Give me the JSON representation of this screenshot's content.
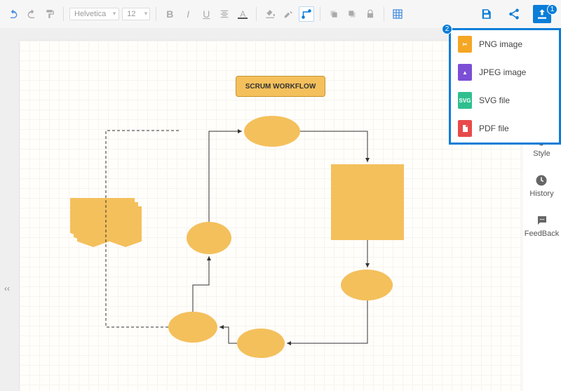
{
  "toolbar": {
    "font": "Helvetica",
    "size": "12"
  },
  "right_buttons": {
    "save": "save",
    "share": "share",
    "export": "export"
  },
  "export_menu": {
    "items": [
      {
        "label": "PNG image",
        "type": "PNG"
      },
      {
        "label": "JPEG image",
        "type": "JPG"
      },
      {
        "label": "SVG file",
        "type": "SVG"
      },
      {
        "label": "PDF file",
        "type": "PDF"
      }
    ]
  },
  "badges": {
    "b1": "1",
    "b2": "2"
  },
  "sidebar": {
    "items": [
      {
        "label": "Style"
      },
      {
        "label": "History"
      },
      {
        "label": "FeedBack"
      }
    ]
  },
  "diagram": {
    "title": "SCRUM WORKFLOW"
  }
}
